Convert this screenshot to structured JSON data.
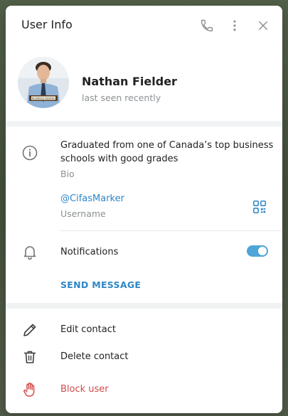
{
  "header": {
    "title": "User Info"
  },
  "profile": {
    "name": "Nathan Fielder",
    "status": "last seen recently",
    "avatar_badge": "BUSINESS DEGREE"
  },
  "bio": {
    "text_line1": "Graduated from one of Canada’s top business",
    "text_line2": "schools with good grades",
    "label": "Bio"
  },
  "username": {
    "value": "@CifasMarker",
    "label": "Username"
  },
  "notifications": {
    "label": "Notifications",
    "enabled": true
  },
  "send_message": "SEND MESSAGE",
  "actions": [
    {
      "label": "Edit contact",
      "icon": "pencil-icon"
    },
    {
      "label": "Delete contact",
      "icon": "trash-icon"
    },
    {
      "label": "Block user",
      "icon": "hand-icon"
    }
  ],
  "colors": {
    "accent": "#2d86c6",
    "toggle_on": "#4fa5da",
    "danger": "#d04b4b",
    "muted": "#8c9194",
    "separator": "#f1f2f3"
  },
  "icons": {
    "phone": "phone-icon",
    "more": "more-vertical-icon",
    "close": "close-icon",
    "info": "info-icon",
    "qr": "qr-code-icon",
    "bell": "bell-icon"
  }
}
